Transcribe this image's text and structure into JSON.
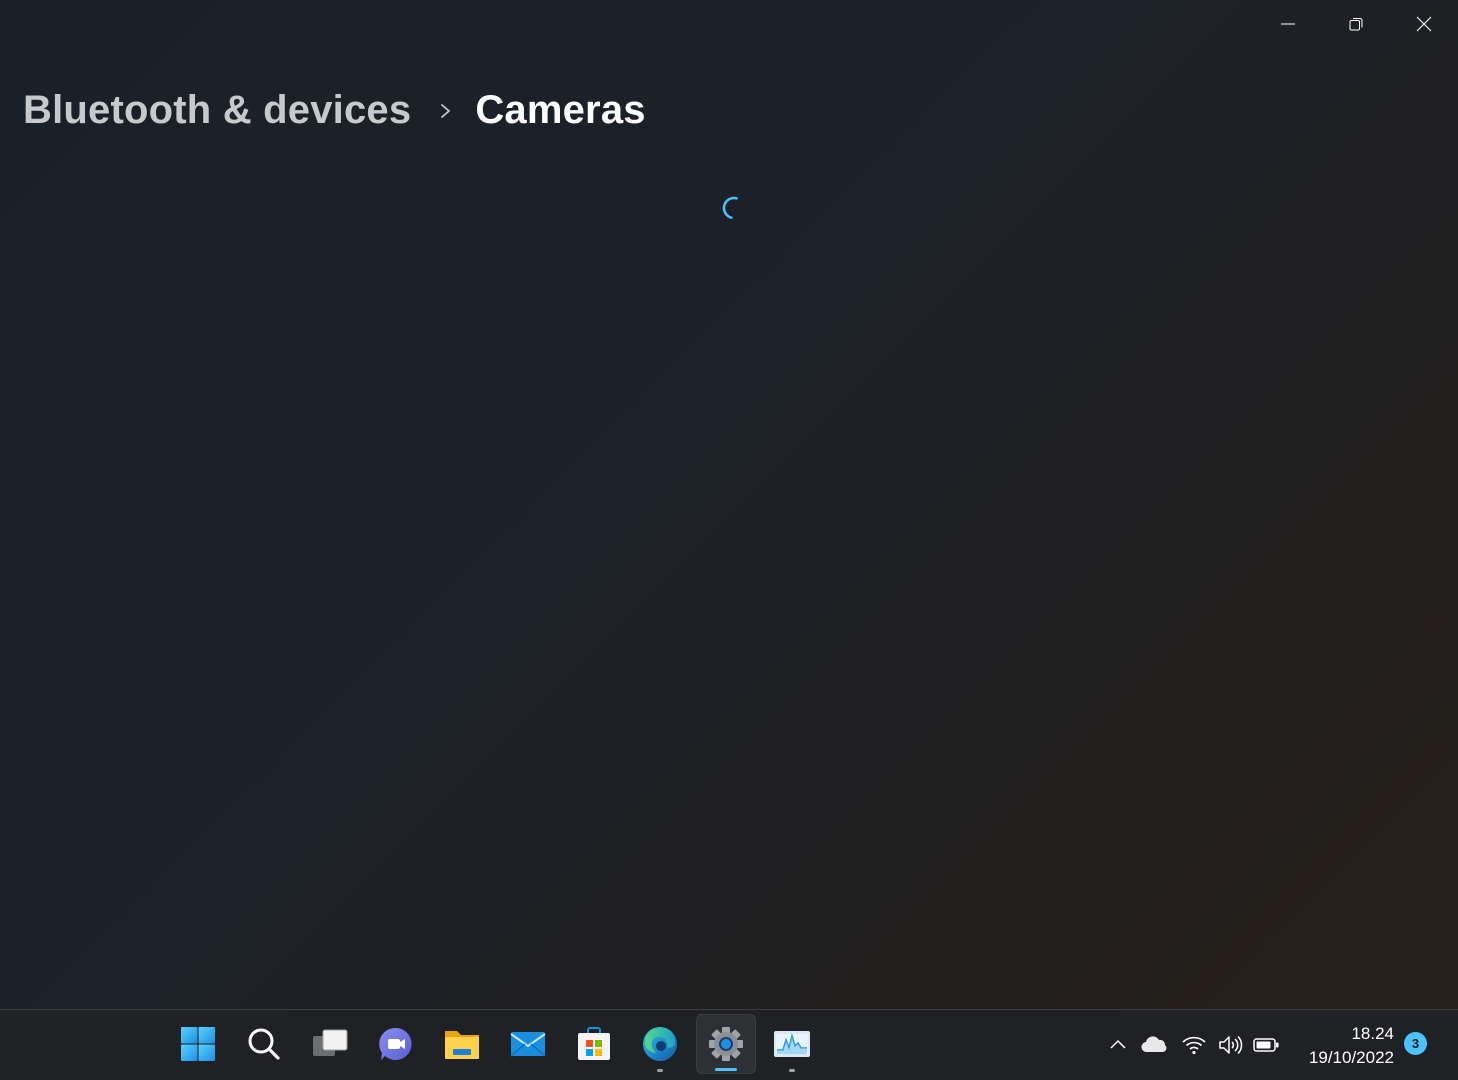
{
  "window": {
    "breadcrumb": {
      "parent": "Bluetooth & devices",
      "current": "Cameras"
    },
    "caption_buttons": [
      "minimize-icon",
      "restore-icon",
      "close-icon"
    ],
    "loading": true
  },
  "taskbar": {
    "apps": [
      {
        "name": "start",
        "icon": "windows-logo-icon",
        "running": false,
        "active": false
      },
      {
        "name": "search",
        "icon": "search-icon",
        "running": false,
        "active": false
      },
      {
        "name": "task-view",
        "icon": "task-view-icon",
        "running": false,
        "active": false
      },
      {
        "name": "chat",
        "icon": "teams-chat-icon",
        "running": false,
        "active": false
      },
      {
        "name": "file-explorer",
        "icon": "folder-icon",
        "running": false,
        "active": false
      },
      {
        "name": "mail",
        "icon": "mail-icon",
        "running": false,
        "active": false
      },
      {
        "name": "microsoft-store",
        "icon": "store-icon",
        "running": false,
        "active": false
      },
      {
        "name": "edge",
        "icon": "edge-icon",
        "running": true,
        "active": false
      },
      {
        "name": "settings",
        "icon": "gear-icon",
        "running": true,
        "active": true
      },
      {
        "name": "task-manager",
        "icon": "task-manager-icon",
        "running": true,
        "active": false
      }
    ],
    "tray": {
      "icons": [
        "chevron-up-icon",
        "onedrive-cloud-icon",
        "wifi-icon",
        "volume-icon",
        "battery-icon"
      ],
      "time": "18.24",
      "date": "19/10/2022",
      "notification_count": "3"
    }
  },
  "colors": {
    "accent": "#4cc2ff",
    "text_secondary": "#c7c9cc"
  }
}
